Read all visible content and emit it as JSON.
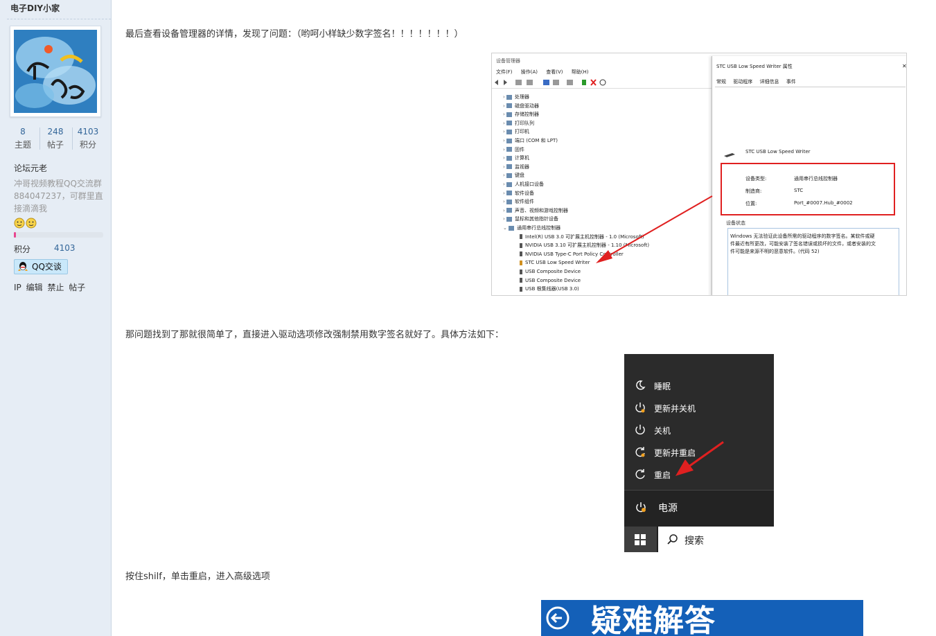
{
  "sidebar": {
    "username": "电子DIY小家",
    "stats": [
      {
        "value": "8",
        "label": "主题"
      },
      {
        "value": "248",
        "label": "帖子"
      },
      {
        "value": "4103",
        "label": "积分"
      }
    ],
    "group": "论坛元老",
    "signature": "冲哥视频教程QQ交流群884047237，可群里直接滴滴我",
    "medal_emoji": "😐😐",
    "level_progress": 0.02,
    "points_label": "积分",
    "points_value": "4103",
    "qq_label": "QQ交谈",
    "admin_links": [
      "IP",
      "编辑",
      "禁止",
      "帖子"
    ],
    "accent": "#336699"
  },
  "post": {
    "para1": "最后查看设备管理器的详情，发现了问题：（哟呵小样缺少数字签名！！！！！！！）",
    "para2": "那问题找到了那就很简单了，直接进入驱动选项修改强制禁用数字签名就好了。具体方法如下：",
    "para3": "按住shilf，单击重启，进入高级选项"
  },
  "device_manager": {
    "title": "设备管理器",
    "menu": [
      "文件(F)",
      "操作(A)",
      "查看(V)",
      "帮助(H)"
    ],
    "tree": [
      "处理器",
      "磁盘驱动器",
      "存储控制器",
      "打印队列",
      "打印机",
      "端口 (COM 和 LPT)",
      "固件",
      "计算机",
      "监视器",
      "键盘",
      "人机接口设备",
      "软件设备",
      "软件组件",
      "声音、视频和游戏控制器",
      "鼠标和其他指针设备",
      "通用串行总线控制器"
    ],
    "usb_children": [
      "Intel(R) USB 3.0 可扩展主机控制器 - 1.0 (Microsoft)",
      "NVIDIA USB 3.10 可扩展主机控制器 - 1.10 (Microsoft)",
      "NVIDIA USB Type-C Port Policy Controller",
      "STC USB Low Speed Writer",
      "USB Composite Device",
      "USB Composite Device",
      "USB 根集线器(USB 3.0)"
    ]
  },
  "properties": {
    "title": "STC USB Low Speed Writer 属性",
    "tabs": [
      "常规",
      "驱动程序",
      "详细信息",
      "事件"
    ],
    "device_name": "STC USB Low Speed Writer",
    "fields": [
      {
        "label": "设备类型:",
        "value": "通用串行总线控制器"
      },
      {
        "label": "制造商:",
        "value": "STC"
      },
      {
        "label": "位置:",
        "value": "Port_#0007.Hub_#0002"
      }
    ],
    "status_title": "设备状态",
    "status_lines": [
      "Windows 无法验证此设备所需的驱动程序的数字签名。某软件或硬",
      "件最近有所更改，可能安装了签名错误或损坏的文件，或者安装的文",
      "件可能是来源不明的恶意软件。(代码 52)"
    ]
  },
  "power_menu": {
    "items": [
      "睡眠",
      "更新并关机",
      "关机",
      "更新并重启",
      "重启"
    ],
    "power_label": "电源",
    "search_label": "搜索"
  },
  "troubleshoot": {
    "title": "疑难解答"
  }
}
